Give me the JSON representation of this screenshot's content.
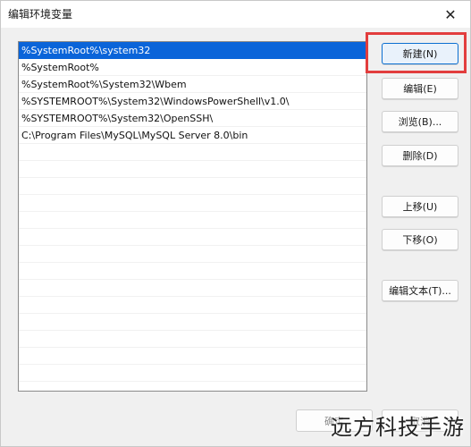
{
  "window": {
    "title": "编辑环境变量",
    "close_glyph": "✕"
  },
  "list": {
    "items": [
      "%SystemRoot%\\system32",
      "%SystemRoot%",
      "%SystemRoot%\\System32\\Wbem",
      "%SYSTEMROOT%\\System32\\WindowsPowerShell\\v1.0\\",
      "%SYSTEMROOT%\\System32\\OpenSSH\\",
      "C:\\Program Files\\MySQL\\MySQL Server 8.0\\bin"
    ],
    "selected_index": 0
  },
  "buttons": {
    "new": "新建(N)",
    "edit": "编辑(E)",
    "browse": "浏览(B)...",
    "delete": "删除(D)",
    "move_up": "上移(U)",
    "move_down": "下移(O)",
    "edit_text": "编辑文本(T)..."
  },
  "footer": {
    "ok": "确定",
    "cancel": "取消"
  },
  "watermark": "远方科技手游",
  "colors": {
    "selection": "#0a64d9",
    "highlight": "#e23d3d"
  }
}
